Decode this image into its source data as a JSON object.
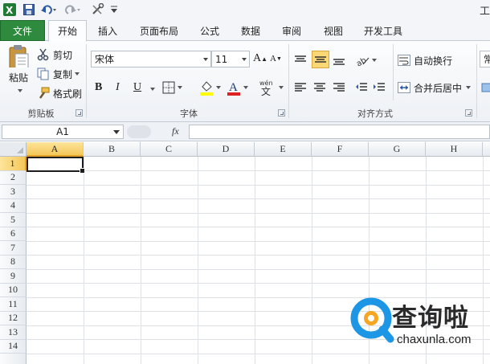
{
  "window": {
    "title_fragment": "工"
  },
  "quick_access": {
    "icons": [
      "excel-logo-icon",
      "save-icon",
      "undo-icon",
      "redo-icon",
      "customize-icon"
    ]
  },
  "tabs": [
    {
      "label": "文件"
    },
    {
      "label": "开始"
    },
    {
      "label": "插入"
    },
    {
      "label": "页面布局"
    },
    {
      "label": "公式"
    },
    {
      "label": "数据"
    },
    {
      "label": "审阅"
    },
    {
      "label": "视图"
    },
    {
      "label": "开发工具"
    }
  ],
  "ribbon": {
    "clipboard": {
      "label": "剪贴板",
      "paste": "粘贴",
      "cut": "剪切",
      "copy": "复制",
      "format_painter": "格式刷"
    },
    "font": {
      "label": "字体",
      "font_name": "宋体",
      "font_size": "11",
      "bold": "B",
      "italic": "I",
      "underline": "U",
      "font_color": "#e02020",
      "fill_color": "#ffff00"
    },
    "alignment": {
      "label": "对齐方式",
      "wrap_text": "自动换行",
      "merge_center": "合并后居中"
    },
    "number": {
      "format_fragment": "常"
    }
  },
  "formula_bar": {
    "name_box": "A1",
    "fx": "fx",
    "value": ""
  },
  "grid": {
    "columns": [
      "A",
      "B",
      "C",
      "D",
      "E",
      "F",
      "G",
      "H"
    ],
    "rows": [
      "1",
      "2",
      "3",
      "4",
      "5",
      "6",
      "7",
      "8",
      "9",
      "10",
      "11",
      "12",
      "13",
      "14"
    ],
    "active_cell": "A1",
    "selection_color": "#f5c75a"
  },
  "watermark": {
    "brand": "查询啦",
    "url": "chaxunla.com",
    "logo_color": "#1e96e6",
    "accent_color": "#f5a623"
  }
}
